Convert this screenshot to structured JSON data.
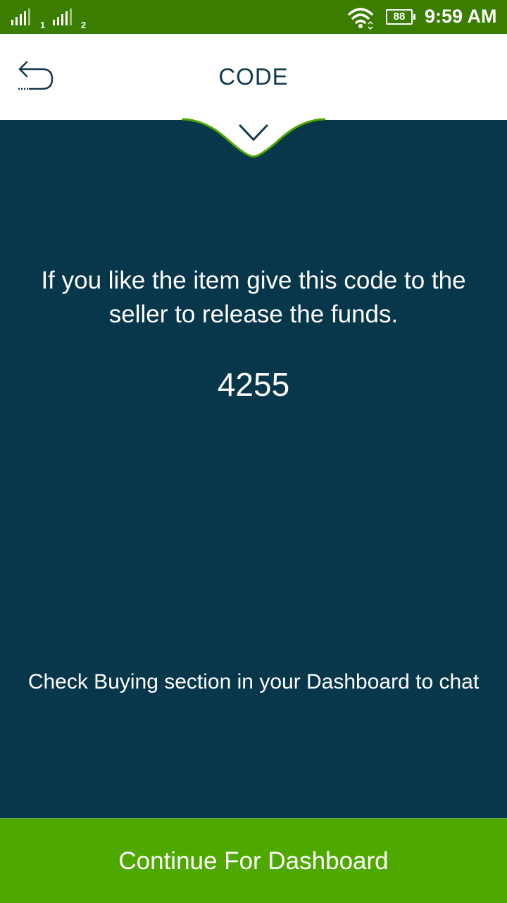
{
  "status_bar": {
    "sim1_label": "1",
    "sim2_label": "2",
    "battery": "88",
    "time": "9:59 AM",
    "icons": [
      "signal-icon",
      "wifi-icon",
      "battery-icon"
    ]
  },
  "header": {
    "title": "CODE",
    "back_icon": "back-arrow-icon",
    "collapse_icon": "chevron-down-icon"
  },
  "main": {
    "message": "If you like the item give this code to the seller to release the funds.",
    "code": "4255",
    "hint": "Check Buying section in your Dashboard to chat"
  },
  "footer": {
    "continue_label": "Continue For Dashboard"
  },
  "colors": {
    "status_bar": "#3a7d00",
    "header_bg": "#ffffff",
    "content_bg": "#08364a",
    "accent_green": "#4fa800",
    "title_text": "#123a4c"
  }
}
